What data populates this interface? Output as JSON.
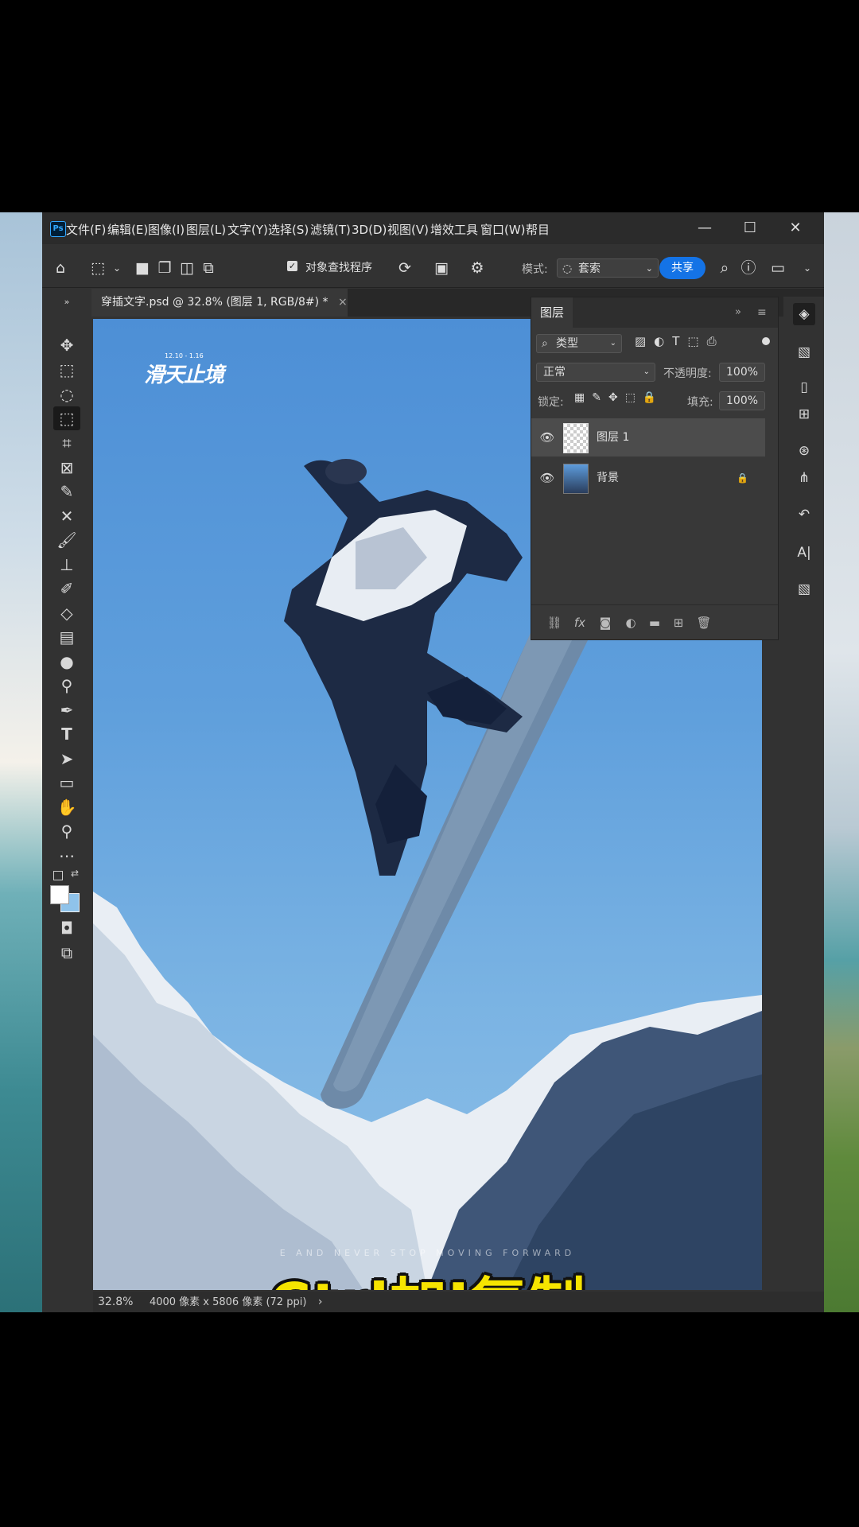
{
  "menu": [
    "文件(F)",
    "编辑(E)",
    "图像(I)",
    "图层(L)",
    "文字(Y)",
    "选择(S)",
    "滤镜(T)",
    "3D(D)",
    "视图(V)",
    "增效工具",
    "窗口(W)",
    "帮目"
  ],
  "window": {
    "min": "—",
    "max": "☐",
    "close": "✕"
  },
  "options": {
    "checkbox_label": "对象查找程序",
    "mode_label": "模式:",
    "mode_value": "套索",
    "share": "共享"
  },
  "doc_tab": {
    "title": "穿插文字.psd @ 32.8% (图层 1, RGB/8#) *",
    "close": "×"
  },
  "status": {
    "zoom": "32.8%",
    "info": "4000 像素 x 5806 像素 (72 ppi)",
    "arrow": "›"
  },
  "layers_panel": {
    "tab": "图层",
    "filter_label": "类型",
    "blend_mode": "正常",
    "opacity_label": "不透明度:",
    "opacity_value": "100%",
    "lock_label": "锁定:",
    "fill_label": "填充:",
    "fill_value": "100%",
    "layers": [
      {
        "name": "图层 1",
        "selected": true
      },
      {
        "name": "背景",
        "locked": true
      }
    ]
  },
  "poster": {
    "title": "滑天止境",
    "date": "12.10 - 1.16",
    "caption": "Ctrl加J复制",
    "tagline": "E AND NEVER STOP MOVING FORWARD"
  },
  "colors": {
    "accent": "#1473e6",
    "caption": "#f6e400",
    "sky": "#5f9fdc"
  }
}
